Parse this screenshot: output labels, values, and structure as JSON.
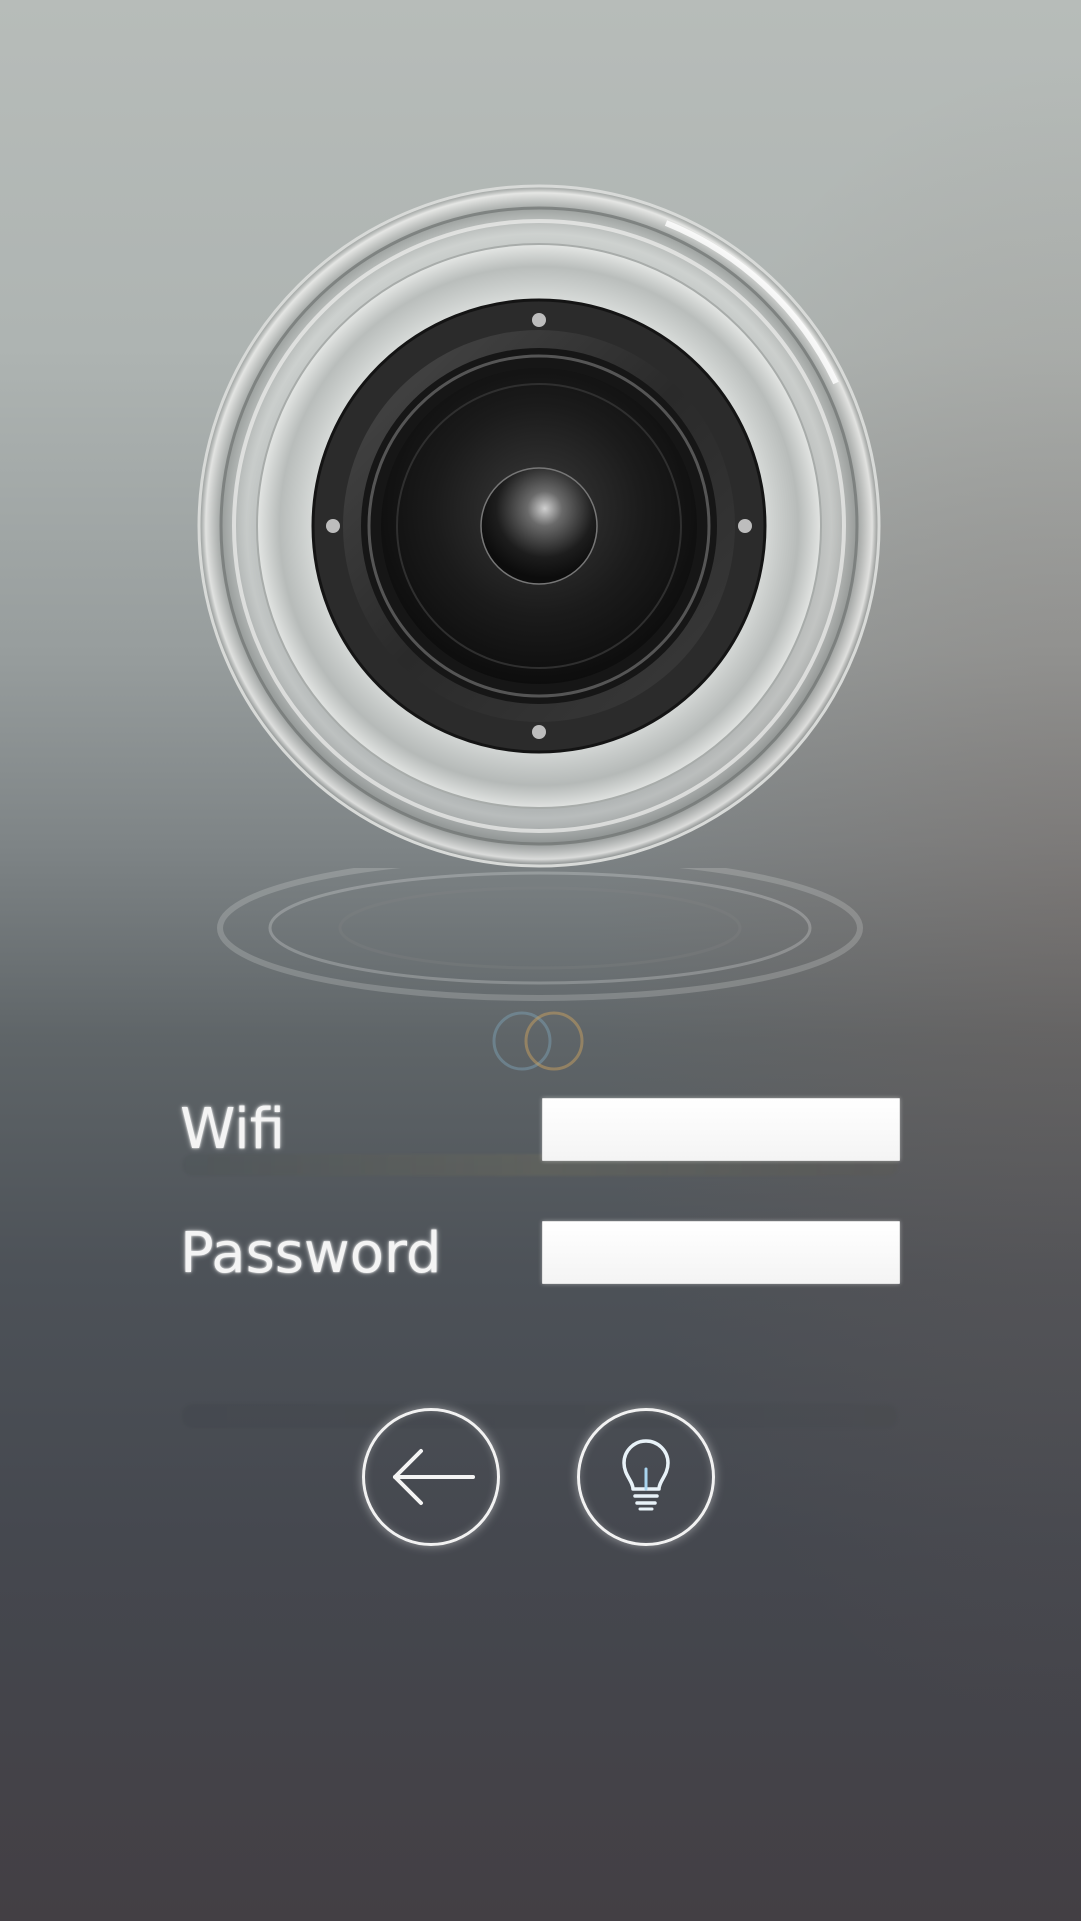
{
  "form": {
    "wifi_label": "Wifi",
    "wifi_value": "",
    "password_label": "Password",
    "password_value": ""
  },
  "buttons": {
    "back_icon": "arrow-left-icon",
    "hint_icon": "lightbulb-icon"
  },
  "colors": {
    "background_top": "#b7bcb9",
    "background_bottom": "#433f44",
    "label_text": "#f4f4f4",
    "field_background": "#ffffff",
    "button_ring": "#f2f2f2"
  }
}
